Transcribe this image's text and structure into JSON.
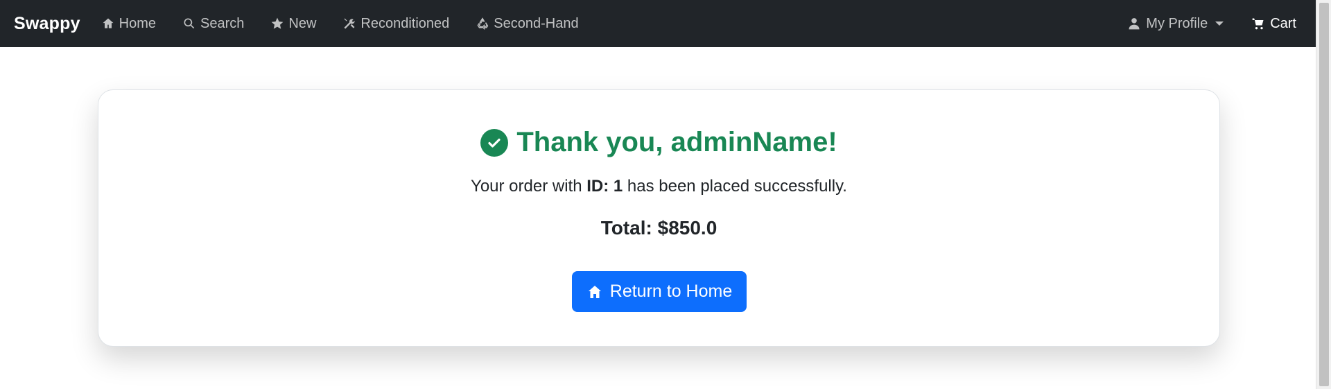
{
  "navbar": {
    "brand": "Swappy",
    "items": [
      {
        "label": "Home",
        "icon": "home-icon"
      },
      {
        "label": "Search",
        "icon": "search-icon"
      },
      {
        "label": "New",
        "icon": "star-icon"
      },
      {
        "label": "Reconditioned",
        "icon": "tools-icon"
      },
      {
        "label": "Second-Hand",
        "icon": "recycle-icon"
      }
    ],
    "profile_label": "My Profile",
    "cart_label": "Cart"
  },
  "confirmation": {
    "title": "Thank you, adminName!",
    "message_prefix": "Your order with ",
    "order_id_label": "ID: 1",
    "message_suffix": " has been placed successfully.",
    "total": "Total: $850.0",
    "button_label": "Return to Home"
  },
  "colors": {
    "navbar_bg": "#212529",
    "success": "#198754",
    "primary": "#0d6efd"
  }
}
